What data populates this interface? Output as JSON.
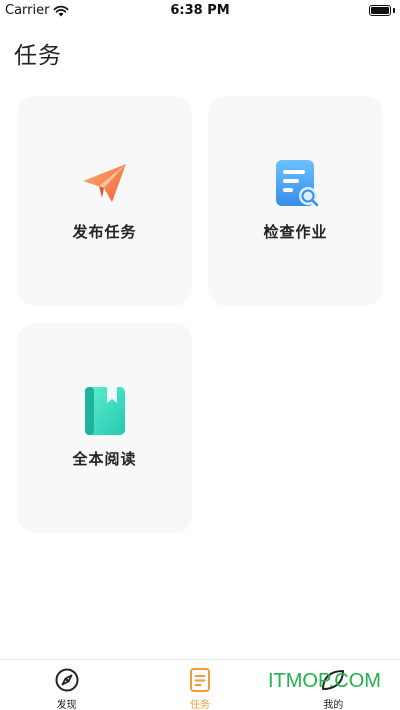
{
  "status_bar": {
    "carrier": "Carrier",
    "time": "6:38 PM"
  },
  "page": {
    "title": "任务"
  },
  "cards": [
    {
      "label": "发布任务",
      "icon": "paper-plane-icon",
      "color": "#f07a45"
    },
    {
      "label": "检查作业",
      "icon": "document-search-icon",
      "color": "#4aa3f0"
    },
    {
      "label": "全本阅读",
      "icon": "book-icon",
      "color": "#3ed9c0"
    }
  ],
  "tab_bar": {
    "tabs": [
      {
        "label": "发现",
        "icon": "compass-icon",
        "active": false
      },
      {
        "label": "任务",
        "icon": "task-list-icon",
        "active": true
      },
      {
        "label": "我的",
        "icon": "profile-icon",
        "active": false
      }
    ],
    "active_color": "#f29a3a"
  },
  "watermark": "ITMOP.COM"
}
